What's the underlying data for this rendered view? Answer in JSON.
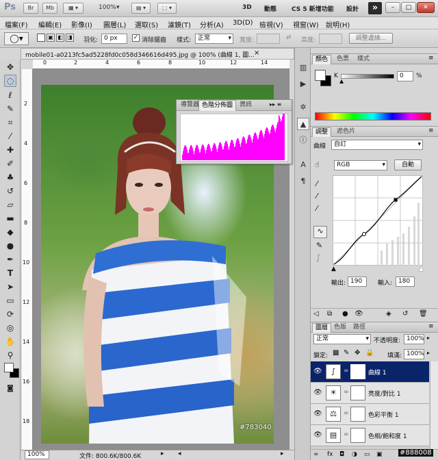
{
  "app": {
    "logo": "Ps",
    "launch_bridge": "Br",
    "mini_bridge": "Mb",
    "zoom": "100%",
    "workspaces": [
      "3D",
      "動態",
      "CS 5 新增功能",
      "設計"
    ],
    "more": "»",
    "window_buttons": {
      "minimize": "–",
      "restore": "□",
      "close": "✕"
    }
  },
  "menu": [
    "檔案(F)",
    "編輯(E)",
    "影像(I)",
    "圖層(L)",
    "選取(S)",
    "濾鏡(T)",
    "分析(A)",
    "3D(D)",
    "檢視(V)",
    "視窗(W)",
    "說明(H)"
  ],
  "options": {
    "feather_label": "羽化:",
    "feather_value": "0 px",
    "antialias_label": "消除鋸齒",
    "style_label": "樣式:",
    "style_value": "正常",
    "width_label": "寬度:",
    "height_label": "高度:",
    "refine_edge": "調整邊緣..."
  },
  "document": {
    "tab_title": "mobile01-a0213fc5ad5228fd0c058d346616d495.jpg @ 100% (曲線 1, 圖...",
    "close": "×",
    "ruler_h": [
      "0",
      "2",
      "4",
      "6",
      "8",
      "10",
      "12",
      "14"
    ],
    "ruler_v": [
      "2",
      "4",
      "6",
      "8",
      "10",
      "12",
      "14",
      "16",
      "18"
    ],
    "watermark": "#783040",
    "zoom": "100%",
    "file_info": "文件: 800.6K/800.6K"
  },
  "histogram_panel": {
    "tabs": [
      "導覽器",
      "色階分佈圖",
      "資訊"
    ],
    "active_tab": "色階分佈圖",
    "menu": "▸▸ ≡"
  },
  "color_panel": {
    "tabs": [
      "顏色",
      "色票",
      "樣式"
    ],
    "channel": "K",
    "value": "0",
    "unit": "%"
  },
  "adjust_panel": {
    "tabs": [
      "調整",
      "遮色片"
    ],
    "title": "曲線",
    "preset": "自訂",
    "channel": "RGB",
    "auto": "自動",
    "output_label": "輸出:",
    "output_value": "190",
    "input_label": "輸入:",
    "input_value": "180"
  },
  "layers_panel": {
    "tabs": [
      "圖層",
      "色版",
      "路徑"
    ],
    "blend_mode": "正常",
    "opacity_label": "不透明度:",
    "opacity_value": "100%",
    "lock_label": "鎖定:",
    "fill_label": "填滿:",
    "fill_value": "100%",
    "layers": [
      {
        "name": "曲線 1",
        "selected": true,
        "icon": "curves-icon",
        "glyph": "∫"
      },
      {
        "name": "亮度/對比 1",
        "selected": false,
        "icon": "brightness-icon",
        "glyph": "☀"
      },
      {
        "name": "色彩平衡 1",
        "selected": false,
        "icon": "balance-icon",
        "glyph": "⚖"
      },
      {
        "name": "色相/飽和度 1",
        "selected": false,
        "icon": "huesat-icon",
        "glyph": "▤"
      }
    ]
  },
  "corner_watermark": "#888008"
}
